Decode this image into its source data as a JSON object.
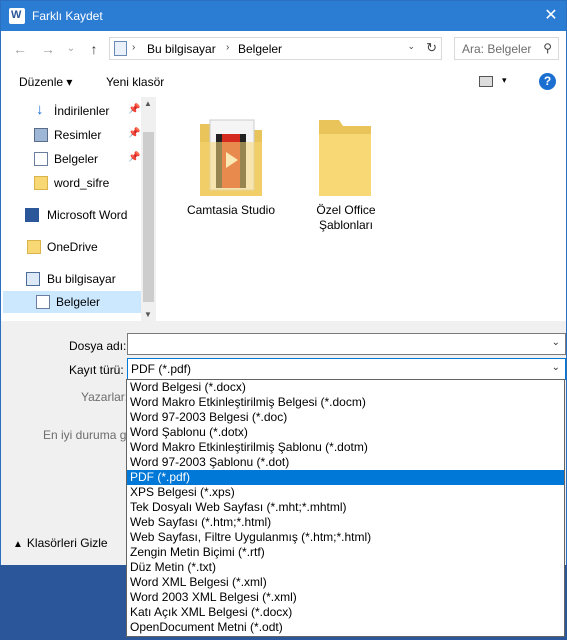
{
  "window": {
    "title": "Farklı Kaydet",
    "close_symbol": "✕"
  },
  "nav_buttons": {
    "back": "←",
    "forward": "→",
    "dropdown": "⌄",
    "up": "↑"
  },
  "address": {
    "crumbs": [
      "Bu bilgisayar",
      "Belgeler"
    ],
    "separator": "›",
    "dropdown": "⌄",
    "refresh": "↻"
  },
  "search": {
    "placeholder": "Ara: Belgeler",
    "icon_symbol": "⚲"
  },
  "toolbar": {
    "organize": "Düzenle ▾",
    "new_folder": "Yeni klasör",
    "view_dropdown": "▾",
    "help": "?"
  },
  "sidebar": {
    "pin_symbol": "📌",
    "items": [
      {
        "label": "İndirilenler",
        "icon": "download-icon",
        "pinned": true
      },
      {
        "label": "Resimler",
        "icon": "pictures-icon",
        "pinned": true
      },
      {
        "label": "Belgeler",
        "icon": "document-icon",
        "pinned": true
      },
      {
        "label": "word_sifre",
        "icon": "folder-icon",
        "pinned": false
      },
      {
        "label": "Microsoft Word",
        "icon": "word-icon",
        "pinned": false
      },
      {
        "label": "OneDrive",
        "icon": "folder-icon",
        "pinned": false
      },
      {
        "label": "Bu bilgisayar",
        "icon": "computer-icon",
        "pinned": false
      },
      {
        "label": "Belgeler",
        "icon": "document-icon",
        "pinned": false,
        "selected": true
      }
    ]
  },
  "scrollbar": {
    "up": "▲",
    "down": "▼"
  },
  "files": [
    {
      "label": "Camtasia Studio",
      "icon": "camtasia-folder-icon"
    },
    {
      "label": "Özel Office Şablonları",
      "label_lines": [
        "Özel Office",
        "Şablonları"
      ],
      "icon": "folder-icon"
    }
  ],
  "form": {
    "filename_label": "Dosya adı:",
    "filename_value": "",
    "filetype_label": "Kayıt türü:",
    "filetype_value": "PDF (*.pdf)",
    "authors_label": "Yazarlar:",
    "optimize_label": "En iyi duruma g",
    "hide_folders": "Klasörleri Gizle",
    "chevron": "⌄",
    "caret": "▲"
  },
  "filetype_options": [
    "Word Belgesi (*.docx)",
    "Word Makro Etkinleştirilmiş Belgesi (*.docm)",
    "Word 97-2003 Belgesi (*.doc)",
    "Word Şablonu (*.dotx)",
    "Word Makro Etkinleştirilmiş Şablonu (*.dotm)",
    "Word 97-2003 Şablonu (*.dot)",
    "PDF (*.pdf)",
    "XPS Belgesi (*.xps)",
    "Tek Dosyalı Web Sayfası (*.mht;*.mhtml)",
    "Web Sayfası (*.htm;*.html)",
    "Web Sayfası, Filtre Uygulanmış (*.htm;*.html)",
    "Zengin Metin Biçimi (*.rtf)",
    "Düz Metin (*.txt)",
    "Word XML Belgesi (*.xml)",
    "Word 2003 XML Belgesi (*.xml)",
    "Katı Açık XML Belgesi (*.docx)",
    "OpenDocument Metni (*.odt)"
  ],
  "selected_filetype": "PDF (*.pdf)",
  "colors": {
    "accent": "#0078d7",
    "titlebar": "#2b7cd3",
    "selection": "#cce8ff"
  }
}
